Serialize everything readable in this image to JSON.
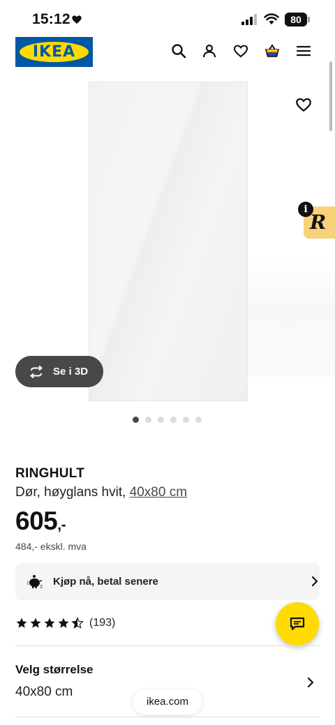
{
  "status_bar": {
    "time": "15:12",
    "battery": "80",
    "icons": [
      "heart-icon",
      "signal-icon",
      "wifi-icon",
      "battery-icon"
    ]
  },
  "header": {
    "logo_text": "IKEA",
    "icons": [
      "search-icon",
      "account-icon",
      "wishlist-icon",
      "cart-icon",
      "menu-icon"
    ]
  },
  "gallery": {
    "view_3d_label": "Se i 3D",
    "slide_count": 6,
    "active_slide": 1,
    "extension_badge": "R",
    "extension_info": "i"
  },
  "product": {
    "name": "RINGHULT",
    "description": "Dør, høyglans hvit, ",
    "size_link": "40x80 cm",
    "price": "605",
    "price_suffix": ",-",
    "price_ex_vat": "484,- ekskl. mva",
    "pay_later_label": "Kjøp nå, betal senere",
    "rating_value": 4.5,
    "rating_count": "(193)"
  },
  "size_selector": {
    "label": "Velg størrelse",
    "value": "40x80 cm"
  },
  "browser": {
    "url": "ikea.com"
  },
  "colors": {
    "ikea_blue": "#0058a3",
    "ikea_yellow": "#ffdb00",
    "dark_pill": "#484848",
    "extension_badge": "#f7d27a"
  }
}
